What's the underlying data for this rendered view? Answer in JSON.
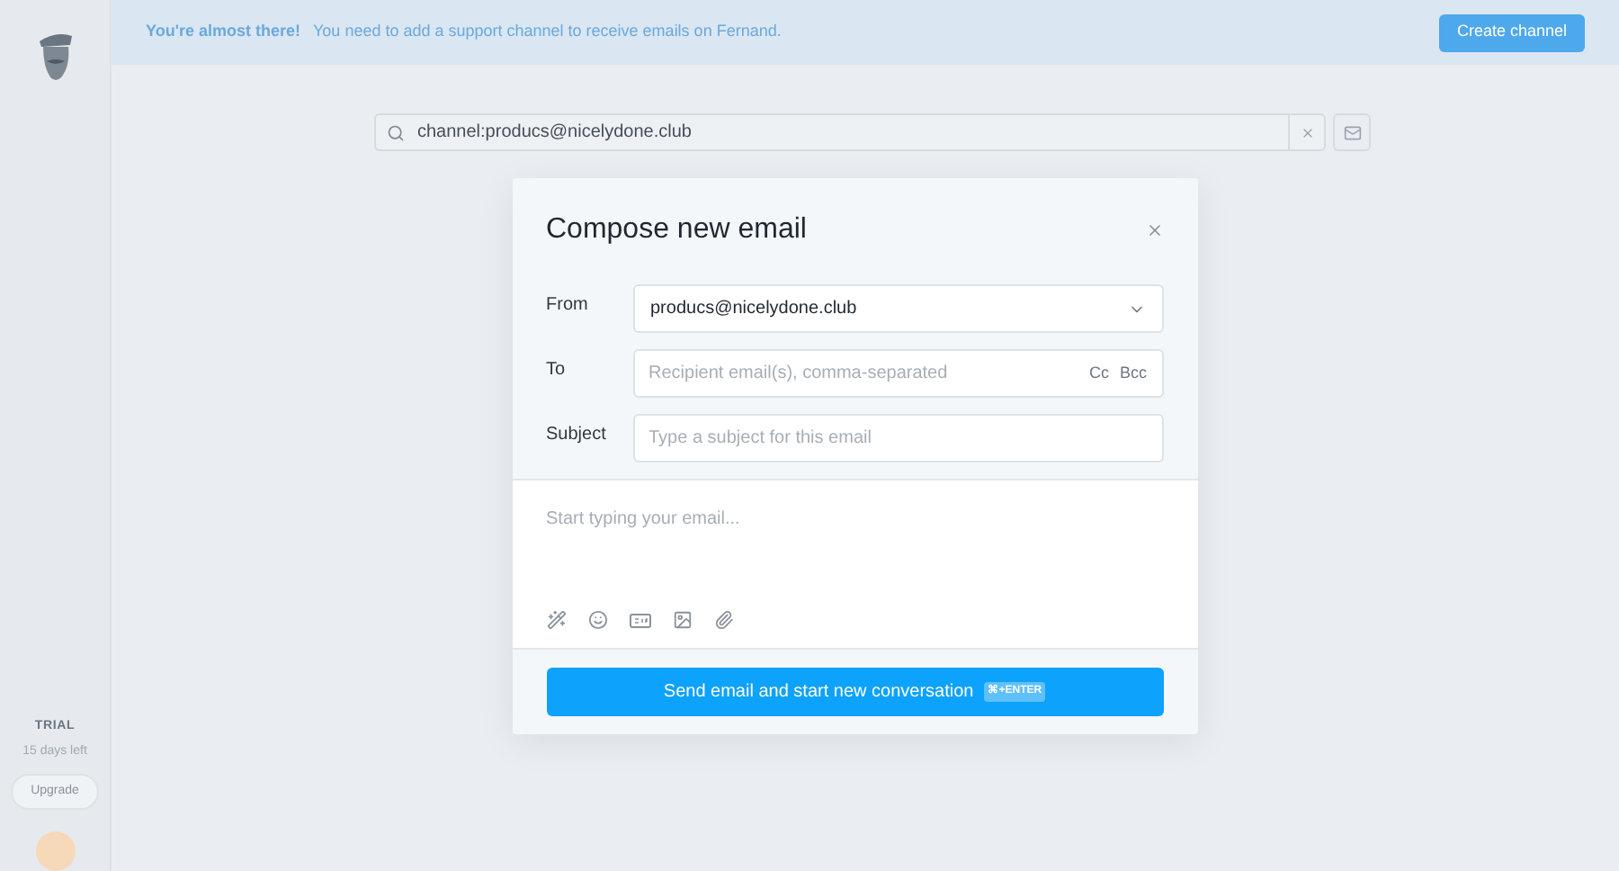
{
  "banner": {
    "title": "You're almost there!",
    "message": "You need to add a support channel to receive emails on Fernand.",
    "button": "Create channel"
  },
  "sidebar": {
    "plan": "TRIAL",
    "days_left": "15 days left",
    "upgrade": "Upgrade"
  },
  "search": {
    "value": "channel:producs@nicelydone.club"
  },
  "compose": {
    "title": "Compose new email",
    "from": {
      "label": "From",
      "value": "producs@nicelydone.club"
    },
    "to": {
      "label": "To",
      "placeholder": "Recipient email(s), comma-separated",
      "cc": "Cc",
      "bcc": "Bcc"
    },
    "subject": {
      "label": "Subject",
      "placeholder": "Type a subject for this email"
    },
    "body": {
      "placeholder": "Start typing your email..."
    },
    "send": {
      "label": "Send email and start new conversation",
      "shortcut": "⌘+ENTER"
    }
  }
}
